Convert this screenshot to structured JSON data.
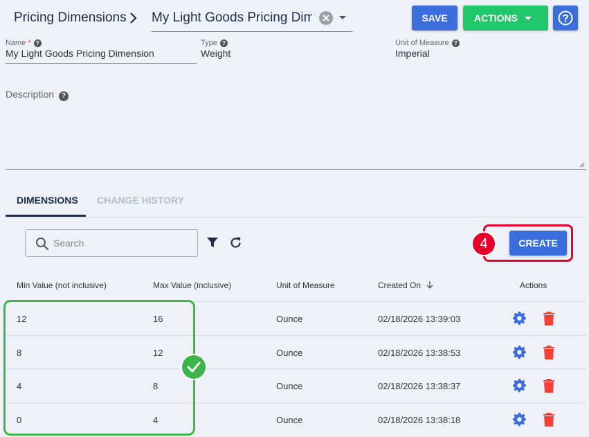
{
  "header": {
    "breadcrumb": "Pricing Dimensions",
    "title_value": "My Light Goods Pricing Dimension",
    "save_label": "SAVE",
    "actions_label": "ACTIONS"
  },
  "form": {
    "name_label": "Name",
    "name_required": "*",
    "name_value": "My Light Goods Pricing Dimension",
    "type_label": "Type",
    "type_value": "Weight",
    "uom_label": "Unit of Measure",
    "uom_value": "Imperial",
    "description_label": "Description",
    "help_glyph": "?"
  },
  "tabs": [
    {
      "label": "DIMENSIONS",
      "active": true
    },
    {
      "label": "CHANGE HISTORY",
      "active": false
    }
  ],
  "toolbar": {
    "search_placeholder": "Search",
    "create_label": "CREATE",
    "step_number": "4"
  },
  "table": {
    "headers": [
      "Min Value (not inclusive)",
      "Max Value (inclusive)",
      "Unit of Measure",
      "Created On",
      "Actions"
    ],
    "rows": [
      {
        "min": "12",
        "max": "16",
        "uom": "Ounce",
        "created": "02/18/2026 13:39:03"
      },
      {
        "min": "8",
        "max": "12",
        "uom": "Ounce",
        "created": "02/18/2026 13:38:53"
      },
      {
        "min": "4",
        "max": "8",
        "uom": "Ounce",
        "created": "02/18/2026 13:38:37"
      },
      {
        "min": "0",
        "max": "4",
        "uom": "Ounce",
        "created": "02/18/2026 13:38:18"
      }
    ]
  },
  "colors": {
    "primary": "#3b6ddc",
    "success": "#1fc76a",
    "danger": "#f44336",
    "highlight_red": "#e4002b",
    "highlight_green": "#3cb54a"
  }
}
